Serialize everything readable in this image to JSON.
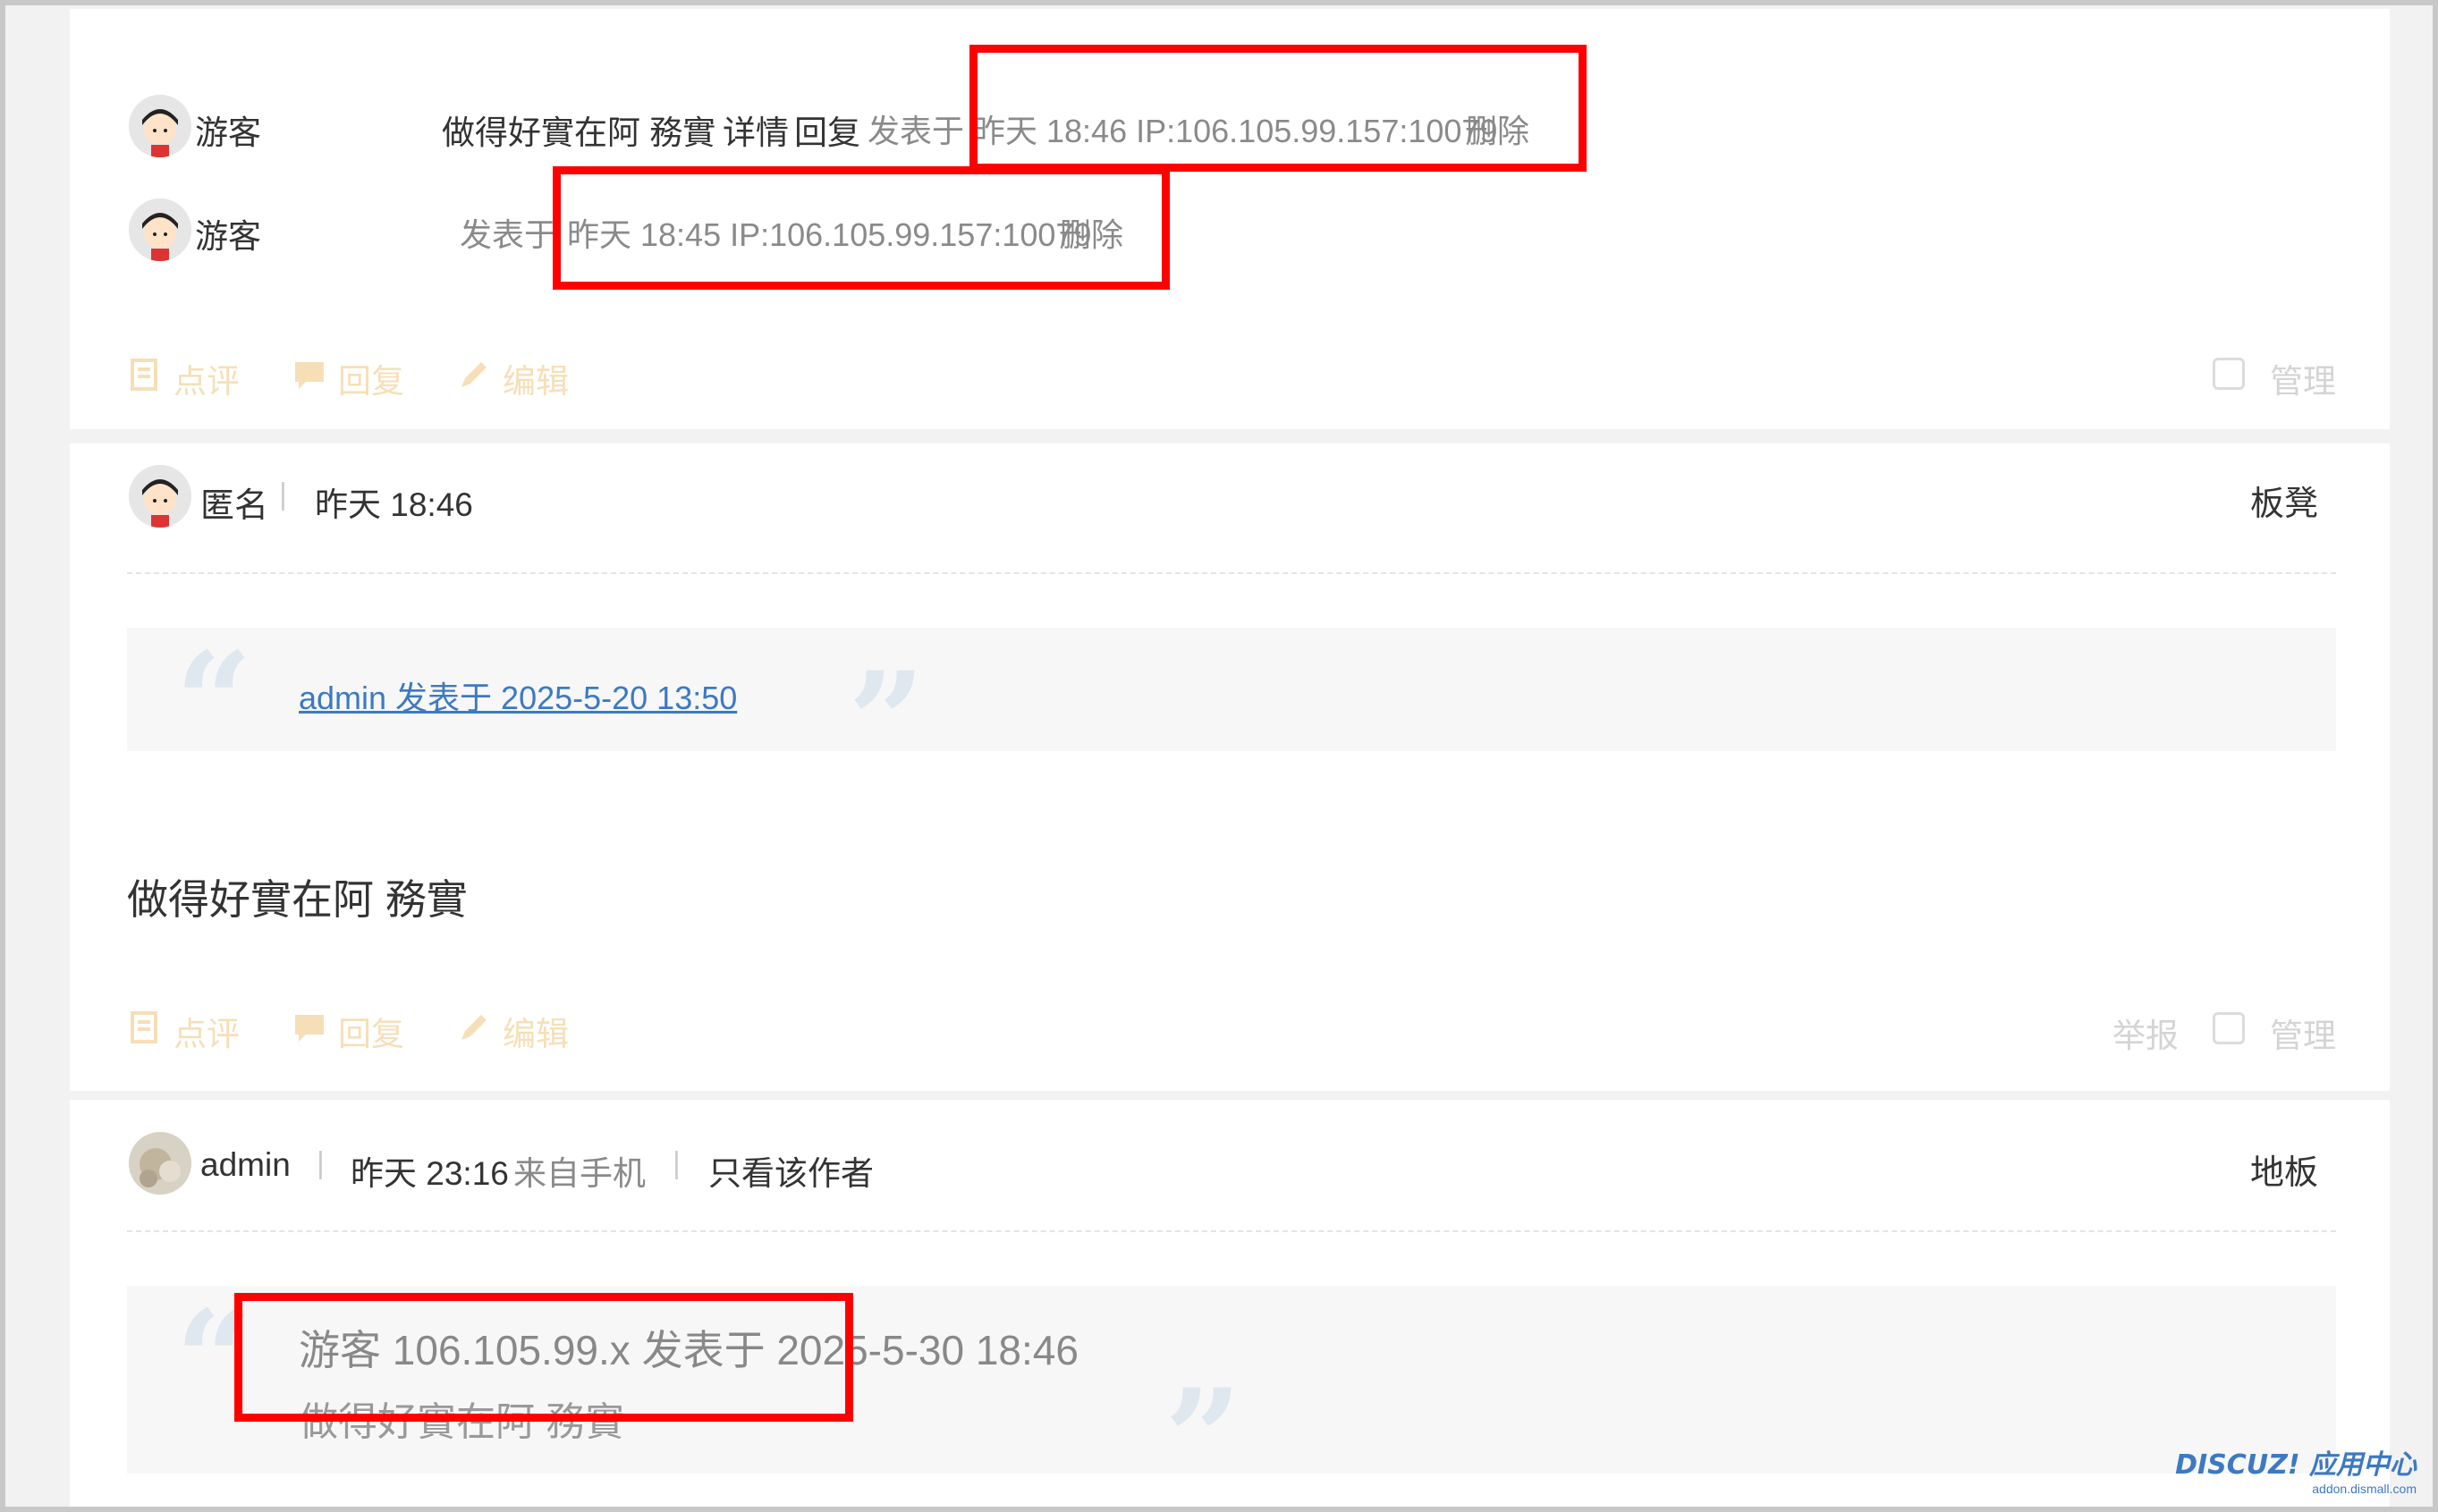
{
  "card1": {
    "row1": {
      "name": "游客",
      "text": "做得好實在阿 務實",
      "detail": "详情",
      "reply": "回复",
      "posted_at": "发表于",
      "time_ip": "昨天 18:46 IP:106.105.99.157:10079",
      "delete": "删除"
    },
    "row2": {
      "name": "游客",
      "posted_at": "发表于",
      "time_ip": "昨天 18:45 IP:106.105.99.157:10079",
      "delete": "删除"
    },
    "actions": {
      "rate": "点评",
      "reply": "回复",
      "edit": "编辑",
      "manage": "管理"
    }
  },
  "card2": {
    "author": "匿名",
    "time": "昨天 18:46",
    "floor": "板凳",
    "quote_link": "admin 发表于 2025-5-20 13:50",
    "body": "做得好實在阿 務實",
    "actions": {
      "rate": "点评",
      "reply": "回复",
      "edit": "编辑",
      "report": "举报",
      "manage": "管理"
    }
  },
  "card3": {
    "author": "admin",
    "time": "昨天 23:16",
    "source": "来自手机",
    "only_author": "只看该作者",
    "floor": "地板",
    "quote_head": "游客 106.105.99.x 发表于 2025-5-30 18:46",
    "quote_body": "做得好實在阿 務實"
  },
  "watermark": {
    "logo": "DISCUZ! 应用中心",
    "sub": "addon.dismall.com"
  },
  "colors": {
    "highlight_box": "#ff0000",
    "action_icon": "#f6dfb7",
    "link": "#3d79c2"
  }
}
